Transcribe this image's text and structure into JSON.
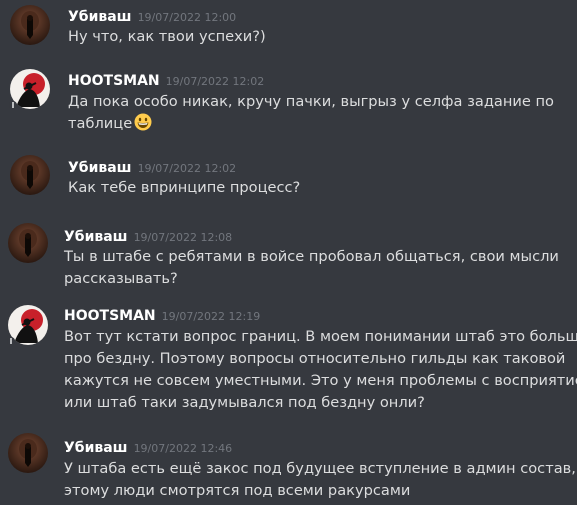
{
  "messages": [
    {
      "author": "Убиваш",
      "timestamp": "19/07/2022 12:00",
      "lines": [
        "Ну что, как твои успехи?)"
      ]
    },
    {
      "author": "HOOTSMAN",
      "timestamp": "19/07/2022 12:02",
      "lines": [
        "Да пока особо никак, кручу пачки, выгрыз у селфа задание по",
        "таблице"
      ],
      "emoji": "grinning-face-emoji"
    },
    {
      "author": "Убиваш",
      "timestamp": "19/07/2022 12:02",
      "lines": [
        "Как тебе впринципе процесс?"
      ]
    },
    {
      "author": "Убиваш",
      "timestamp": "19/07/2022 12:08",
      "lines": [
        "Ты в штабе с ребятами в войсе пробовал общаться, свои мысли",
        "рассказывать?"
      ]
    },
    {
      "author": "HOOTSMAN",
      "timestamp": "19/07/2022 12:19",
      "lines": [
        "Вот тут кстати вопрос границ. В моем понимании штаб это больше",
        "про бездну. Поэтому вопросы относительно гильды как таковой",
        "кажутся не совсем уместными. Это у меня проблемы с восприятием",
        "или штаб таки задумывался под бездну онли?"
      ]
    },
    {
      "author": "Убиваш",
      "timestamp": "19/07/2022 12:46",
      "lines": [
        "У штаба есть ещё закос под будущее вступление в админ состав, по",
        "этому люди смотрятся под всеми ракурсами"
      ]
    }
  ],
  "colors": {
    "background": "#36393f",
    "author": "#ffffff",
    "timestamp": "#72767d",
    "text": "#dcddde"
  }
}
